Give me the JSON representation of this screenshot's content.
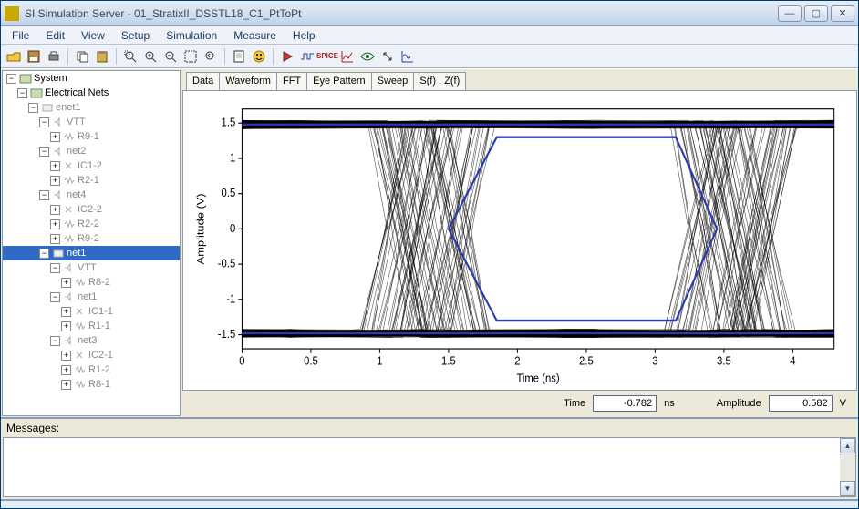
{
  "window": {
    "title": "SI Simulation Server - 01_StratixII_DSSTL18_C1_PtToPt"
  },
  "menu": {
    "items": [
      "File",
      "Edit",
      "View",
      "Setup",
      "Simulation",
      "Measure",
      "Help"
    ]
  },
  "tree": {
    "root": {
      "label": "System"
    },
    "l1": {
      "label": "Electrical Nets"
    },
    "enet1": {
      "label": "enet1"
    },
    "vtt1": {
      "label": "VTT"
    },
    "r91": {
      "label": "R9-1"
    },
    "net2": {
      "label": "net2"
    },
    "ic12": {
      "label": "IC1-2"
    },
    "r21": {
      "label": "R2-1"
    },
    "net4": {
      "label": "net4"
    },
    "ic22": {
      "label": "IC2-2"
    },
    "r22": {
      "label": "R2-2"
    },
    "r92": {
      "label": "R9-2"
    },
    "net1": {
      "label": "net1"
    },
    "vtt2": {
      "label": "VTT"
    },
    "r82": {
      "label": "R8-2"
    },
    "net1b": {
      "label": "net1"
    },
    "ic11": {
      "label": "IC1-1"
    },
    "r11": {
      "label": "R1-1"
    },
    "net3": {
      "label": "net3"
    },
    "ic21": {
      "label": "IC2-1"
    },
    "r12": {
      "label": "R1-2"
    },
    "r81": {
      "label": "R8-1"
    }
  },
  "tabs": {
    "data": "Data",
    "waveform": "Waveform",
    "fft": "FFT",
    "eye": "Eye Pattern",
    "sweep": "Sweep",
    "sfzf": "S(f) , Z(f)"
  },
  "plot": {
    "xlabel": "Time (ns)",
    "ylabel": "Amplitude (V)",
    "xticks": [
      "0",
      "0.5",
      "1",
      "1.5",
      "2",
      "2.5",
      "3",
      "3.5",
      "4"
    ],
    "yticks": [
      "-1.5",
      "-1",
      "-0.5",
      "0",
      "0.5",
      "1",
      "1.5"
    ]
  },
  "readout": {
    "time_label": "Time",
    "time_val": "-0.782",
    "time_unit": "ns",
    "amp_label": "Amplitude",
    "amp_val": "0.582",
    "amp_unit": "V"
  },
  "messages": {
    "header": "Messages:"
  },
  "chart_data": {
    "type": "line",
    "title": "Eye Diagram",
    "xlabel": "Time (ns)",
    "ylabel": "Amplitude (V)",
    "xlim": [
      0,
      4.3
    ],
    "ylim": [
      -1.7,
      1.7
    ],
    "eye_mask_polygon_x": [
      1.5,
      1.85,
      3.15,
      3.45,
      3.15,
      1.85,
      1.5
    ],
    "eye_mask_polygon_y": [
      0,
      1.3,
      1.3,
      0,
      -1.3,
      -1.3,
      0
    ],
    "rails": {
      "high": 1.48,
      "low": -1.48
    },
    "crossing_centers_ns": [
      1.35,
      3.55
    ],
    "crossing_width_ns": 0.65
  }
}
